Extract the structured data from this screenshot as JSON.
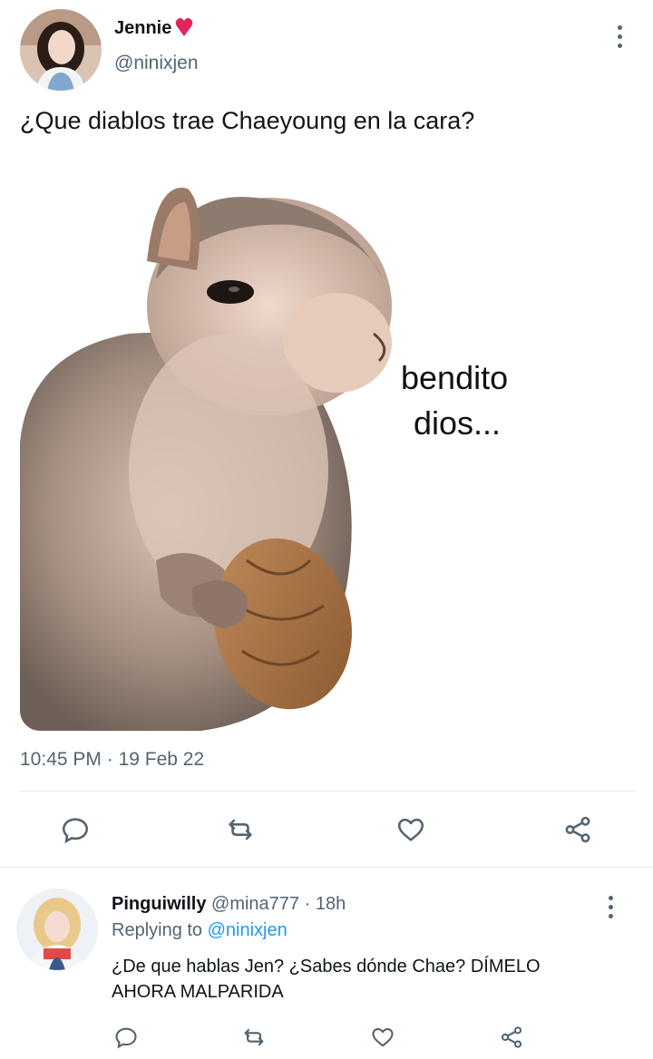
{
  "tweet": {
    "author_name": "Jennie",
    "author_handle": "@ninixjen",
    "text": "¿Que diablos trae Chaeyoung en la cara?",
    "meme_caption_line1": "bendito",
    "meme_caption_line2": "dios...",
    "time": "10:45 PM",
    "separator": " · ",
    "date": "19 Feb 22",
    "actions": [
      "reply-icon",
      "retweet-icon",
      "like-icon",
      "share-icon"
    ]
  },
  "reply": {
    "author_name": "Pinguiwilly",
    "author_handle": "@mina777",
    "separator": " · ",
    "time_ago": "18h",
    "replying_prefix": "Replying to ",
    "replying_to": "@ninixjen",
    "text_line1": "¿De que hablas Jen? ¿Sabes dónde Chae? DÍMELO",
    "text_line2": "AHORA MALPARIDA",
    "actions": [
      "reply-icon",
      "retweet-icon",
      "like-icon",
      "share-icon"
    ]
  },
  "colors": {
    "accent": "#1d9bf0",
    "heart": "#e0245e",
    "secondary_text": "#536471",
    "divider": "#e6e9ec"
  }
}
